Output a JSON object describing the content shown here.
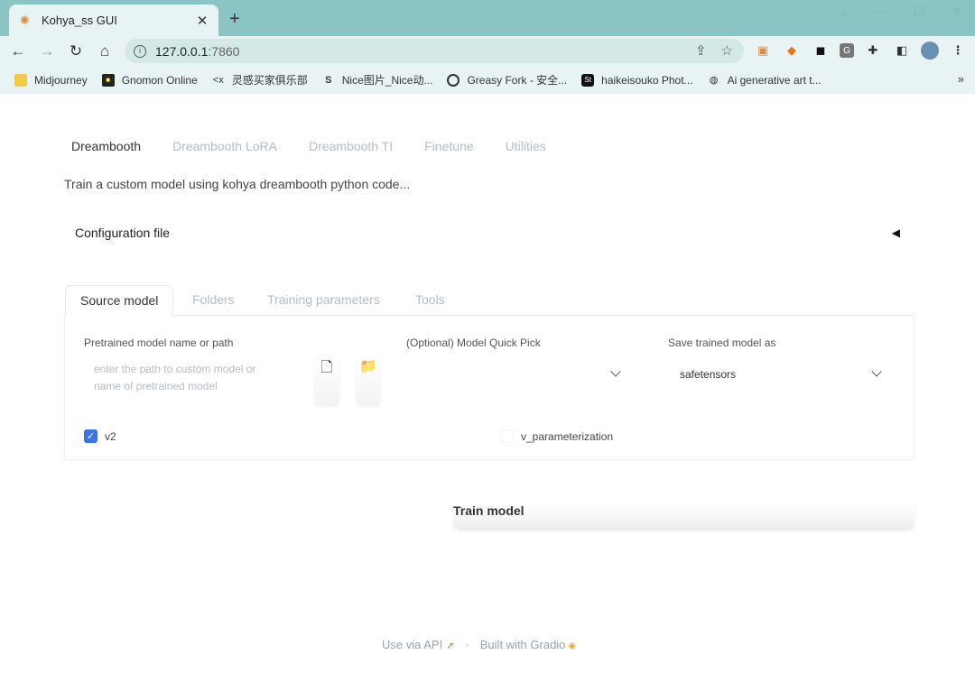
{
  "browser": {
    "tab_title": "Kohya_ss GUI",
    "new_tab": "+",
    "url_host": "127.0.0.1",
    "url_port": ":7860",
    "bookmarks": [
      {
        "label": "Midjourney",
        "icon": "folder-icon"
      },
      {
        "label": "Gnomon Online",
        "icon": "gnomon-icon"
      },
      {
        "label": "灵感买家俱乐部",
        "icon": "linggan-icon"
      },
      {
        "label": "Nice图片_Nice动...",
        "icon": "nice-icon"
      },
      {
        "label": "Greasy Fork - 安全...",
        "icon": "greasyfork-icon"
      },
      {
        "label": "haikeisouko Phot...",
        "icon": "haikei-icon"
      },
      {
        "label": "Ai generative art t...",
        "icon": "globe-icon"
      }
    ],
    "more_bookmarks": "»"
  },
  "main_tabs": [
    "Dreambooth",
    "Dreambooth LoRA",
    "Dreambooth TI",
    "Finetune",
    "Utilities"
  ],
  "description": "Train a custom model using kohya dreambooth python code...",
  "config": {
    "label": "Configuration file",
    "arrow": "◀"
  },
  "sub_tabs": [
    "Source model",
    "Folders",
    "Training parameters",
    "Tools"
  ],
  "source_model": {
    "pretrained_label": "Pretrained model name or path",
    "pretrained_placeholder": "enter the path to custom model or name of pretrained model",
    "quick_pick_label": "(Optional) Model Quick Pick",
    "quick_pick_value": "",
    "save_as_label": "Save trained model as",
    "save_as_value": "safetensors",
    "v2_label": "v2",
    "v2_checked": true,
    "v_param_label": "v_parameterization",
    "v_param_checked": false
  },
  "train_button": "Train model",
  "footer": {
    "api": "Use via API",
    "separator": "·",
    "built": "Built with Gradio"
  }
}
